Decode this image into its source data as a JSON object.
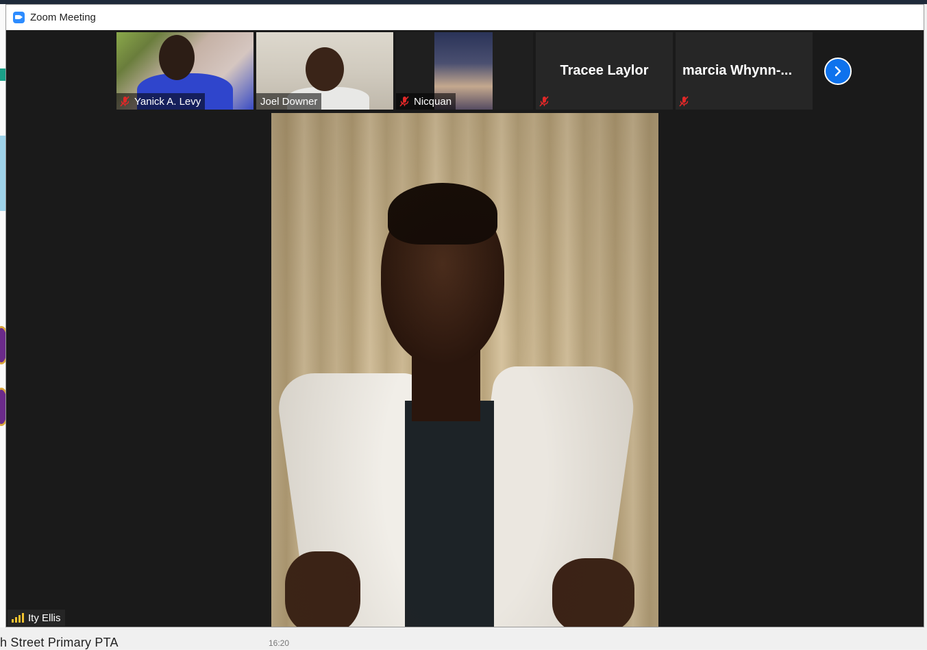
{
  "window": {
    "title": "Zoom Meeting"
  },
  "thumbnails": [
    {
      "name": "Yanick A. Levy",
      "muted": true,
      "video": true
    },
    {
      "name": "Joel Downer",
      "muted": false,
      "video": true
    },
    {
      "name": "Nicquan",
      "muted": true,
      "video": true
    },
    {
      "name": "Tracee Laylor",
      "muted": true,
      "video": false
    },
    {
      "name": "marcia  Whynn-...",
      "muted": true,
      "video": false
    }
  ],
  "active_speaker": {
    "name": "Ity Ellis"
  },
  "background_app": {
    "chat_title": "h Street Primary PTA",
    "chat_time": "16:20"
  },
  "colors": {
    "zoom_blue": "#2d8cff",
    "mute_red": "#e02828",
    "signal_yellow": "#f2c230",
    "next_button": "#0e72ed"
  },
  "icons": {
    "mute": "microphone-muted-icon",
    "next": "chevron-right-icon",
    "signal": "signal-bars-icon"
  }
}
